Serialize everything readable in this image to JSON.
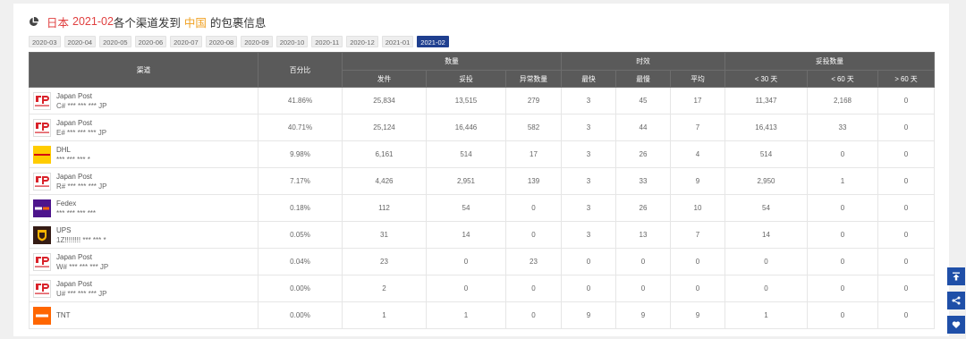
{
  "title": {
    "country": "日本",
    "period": "2021-02",
    "text_mid": "各个渠道发到",
    "dest": "中国",
    "text_end": "的包裹信息"
  },
  "months": [
    "2020-03",
    "2020-04",
    "2020-05",
    "2020-06",
    "2020-07",
    "2020-08",
    "2020-09",
    "2020-10",
    "2020-11",
    "2020-12",
    "2021-01",
    "2021-02"
  ],
  "active_month": "2021-02",
  "table": {
    "headers": {
      "channel": "渠道",
      "percent": "百分比",
      "group_qty": "数量",
      "group_time": "时效",
      "group_delivered": "妥投数量",
      "sent": "发件",
      "delivered": "妥投",
      "abnormal": "异常数量",
      "fastest": "最快",
      "slowest": "最慢",
      "average": "平均",
      "lt30": "< 30 天",
      "lt60": "< 60 天",
      "gt60": "> 60 天"
    },
    "rows": [
      {
        "name": "Japan Post",
        "code": "C# *** *** *** JP",
        "logo": "japan-post",
        "percent": "41.86%",
        "sent": "25,834",
        "delivered": "13,515",
        "abnormal": "279",
        "fastest": "3",
        "slowest": "45",
        "average": "17",
        "lt30": "11,347",
        "lt60": "2,168",
        "gt60": "0"
      },
      {
        "name": "Japan Post",
        "code": "E# *** *** *** JP",
        "logo": "japan-post",
        "percent": "40.71%",
        "sent": "25,124",
        "delivered": "16,446",
        "abnormal": "582",
        "fastest": "3",
        "slowest": "44",
        "average": "7",
        "lt30": "16,413",
        "lt60": "33",
        "gt60": "0"
      },
      {
        "name": "DHL",
        "code": "*** *** *** *",
        "logo": "dhl",
        "percent": "9.98%",
        "sent": "6,161",
        "delivered": "514",
        "abnormal": "17",
        "fastest": "3",
        "slowest": "26",
        "average": "4",
        "lt30": "514",
        "lt60": "0",
        "gt60": "0"
      },
      {
        "name": "Japan Post",
        "code": "R# *** *** *** JP",
        "logo": "japan-post",
        "percent": "7.17%",
        "sent": "4,426",
        "delivered": "2,951",
        "abnormal": "139",
        "fastest": "3",
        "slowest": "33",
        "average": "9",
        "lt30": "2,950",
        "lt60": "1",
        "gt60": "0"
      },
      {
        "name": "Fedex",
        "code": "*** *** *** ***",
        "logo": "fedex",
        "percent": "0.18%",
        "sent": "112",
        "delivered": "54",
        "abnormal": "0",
        "fastest": "3",
        "slowest": "26",
        "average": "10",
        "lt30": "54",
        "lt60": "0",
        "gt60": "0"
      },
      {
        "name": "UPS",
        "code": "1Z!!!!!!!! *** *** *",
        "logo": "ups",
        "percent": "0.05%",
        "sent": "31",
        "delivered": "14",
        "abnormal": "0",
        "fastest": "3",
        "slowest": "13",
        "average": "7",
        "lt30": "14",
        "lt60": "0",
        "gt60": "0"
      },
      {
        "name": "Japan Post",
        "code": "W# *** *** *** JP",
        "logo": "japan-post",
        "percent": "0.04%",
        "sent": "23",
        "delivered": "0",
        "abnormal": "23",
        "fastest": "0",
        "slowest": "0",
        "average": "0",
        "lt30": "0",
        "lt60": "0",
        "gt60": "0"
      },
      {
        "name": "Japan Post",
        "code": "U# *** *** *** JP",
        "logo": "japan-post",
        "percent": "0.00%",
        "sent": "2",
        "delivered": "0",
        "abnormal": "0",
        "fastest": "0",
        "slowest": "0",
        "average": "0",
        "lt30": "0",
        "lt60": "0",
        "gt60": "0"
      },
      {
        "name": "TNT",
        "code": "",
        "logo": "tnt",
        "percent": "0.00%",
        "sent": "1",
        "delivered": "1",
        "abnormal": "0",
        "fastest": "9",
        "slowest": "9",
        "average": "9",
        "lt30": "1",
        "lt60": "0",
        "gt60": "0"
      }
    ]
  },
  "side_buttons": [
    "back-to-top-icon",
    "share-icon",
    "heart-icon"
  ],
  "colors": {
    "accent": "#1f3f8f",
    "highlight": "#f0a020",
    "header_bg": "#5a5a5a"
  }
}
